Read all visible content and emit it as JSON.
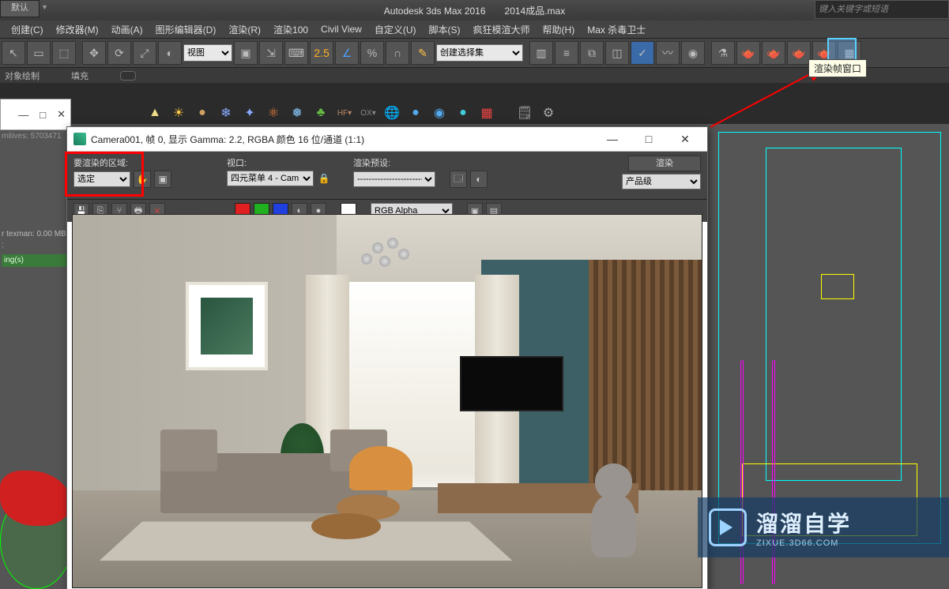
{
  "app": {
    "title": "Autodesk 3ds Max 2016　　2014成品.max",
    "default_tab": "默认",
    "search_placeholder": "键入关键字或短语"
  },
  "menu": {
    "items": [
      "创建(C)",
      "修改器(M)",
      "动画(A)",
      "图形编辑器(D)",
      "渲染(R)",
      "渲染100",
      "Civil View",
      "自定义(U)",
      "脚本(S)",
      "疯狂模渲大师",
      "帮助(H)",
      "Max 杀毒卫士"
    ]
  },
  "toolbar": {
    "view_dropdown": "视图",
    "selection_set": "创建选择集"
  },
  "subbar": {
    "label1": "对象绘制",
    "label2": "填充"
  },
  "tooltip": "渲染帧窗口",
  "render_window": {
    "title": "Camera001, 帧 0, 显示 Gamma: 2.2, RGBA 颜色 16 位/通道 (1:1)",
    "area_label": "要渲染的区域:",
    "area_value": "选定",
    "viewport_label": "视口:",
    "viewport_value": "四元菜单 4 - Cam",
    "preset_label": "渲染预设:",
    "preset_value": "-------------------------",
    "render_btn": "渲染",
    "quality_value": "产品级",
    "channel_value": "RGB Alpha"
  },
  "left": {
    "primitives": "mitives: 5703471",
    "texman": "r texman: 0.00 MB",
    "loading": "ing(s)"
  },
  "watermark": {
    "brand": "溜溜自学",
    "url": "ZIXUE.3D66.COM"
  }
}
